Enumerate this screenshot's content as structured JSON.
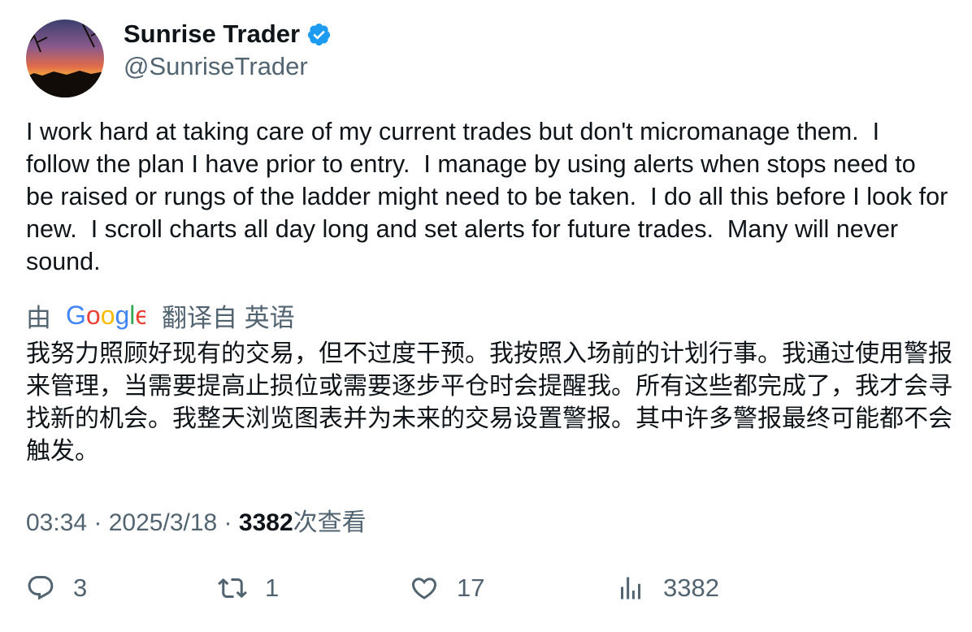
{
  "author": {
    "display_name": "Sunrise Trader",
    "handle": "@SunriseTrader",
    "verified": true,
    "avatar_icon": "sunset-photo-avatar"
  },
  "tweet": {
    "text": "I work hard at taking care of my current trades but don't micromanage them.  I follow the plan I have prior to entry.  I manage by using alerts when stops need to be raised or rungs of the ladder might need to be taken.  I do all this before I look for new.  I scroll charts all day long and set alerts for future trades.  Many will never sound."
  },
  "translation": {
    "prefix": "由",
    "provider": "Google",
    "suffix": "翻译自 英语",
    "text": "我努力照顾好现有的交易，但不过度干预。我按照入场前的计划行事。我通过使用警报来管理，当需要提高止损位或需要逐步平仓时会提醒我。所有这些都完成了，我才会寻找新的机会。我整天浏览图表并为未来的交易设置警报。其中许多警报最终可能都不会触发。"
  },
  "meta": {
    "time": "03:34",
    "separator": " · ",
    "date": "2025/3/18",
    "views": "3382",
    "views_label": "次查看"
  },
  "actions": {
    "replies": "3",
    "retweets": "1",
    "likes": "17",
    "views": "3382"
  },
  "colors": {
    "text": "#0f1419",
    "secondary": "#536471",
    "verified": "#1d9bf0"
  }
}
